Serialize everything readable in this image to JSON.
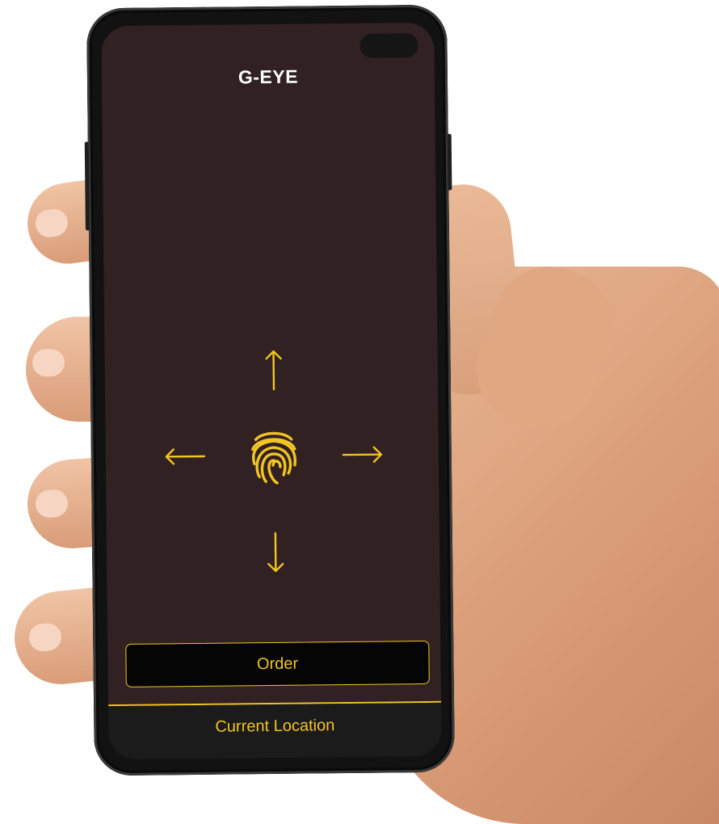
{
  "app": {
    "title": "G-EYE"
  },
  "controls": {
    "up_icon": "arrow-up",
    "down_icon": "arrow-down",
    "left_icon": "arrow-left",
    "right_icon": "arrow-right",
    "center_icon": "fingerprint",
    "accent_color": "#f2c523"
  },
  "actions": {
    "order_label": "Order",
    "location_label": "Current Location"
  },
  "theme": {
    "screen_bg": "#312122",
    "bar_bg": "#1b1b1b"
  }
}
